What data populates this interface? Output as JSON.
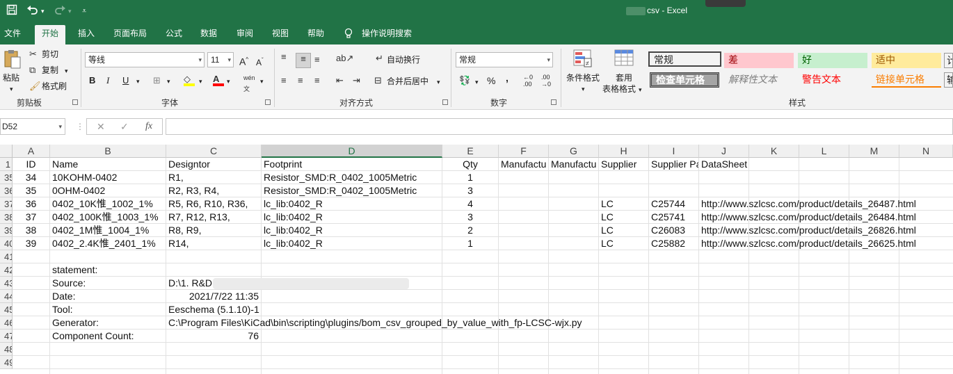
{
  "window": {
    "title_suffix": "csv  -  Excel"
  },
  "qat": {
    "save_icon": "save-icon",
    "undo_icon": "undo-icon",
    "redo_icon": "redo-icon",
    "customize_icon": "chevron-down-icon"
  },
  "tabs": [
    "文件",
    "开始",
    "插入",
    "页面布局",
    "公式",
    "数据",
    "审阅",
    "视图",
    "帮助"
  ],
  "tell_me": "操作说明搜索",
  "ribbon": {
    "clipboard": {
      "paste": "粘贴",
      "cut": "剪切",
      "copy": "复制",
      "format_painter": "格式刷",
      "label": "剪贴板"
    },
    "font": {
      "name": "等线",
      "size": "11",
      "bold": "B",
      "italic": "I",
      "underline": "U",
      "label": "字体",
      "grow": "A",
      "shrink": "A",
      "wen": "wén"
    },
    "alignment": {
      "wrap": "自动换行",
      "merge": "合并后居中",
      "label": "对齐方式"
    },
    "number": {
      "format": "常规",
      "percent": "%",
      "comma": ",",
      "label": "数字"
    },
    "styles": {
      "conditional": "条件格式",
      "table1": "套用",
      "table2": "表格格式",
      "label": "样式",
      "cells": [
        {
          "text": "常规",
          "bg": "#ffffff",
          "color": "#000000"
        },
        {
          "text": "差",
          "bg": "#ffc7ce",
          "color": "#9c0006"
        },
        {
          "text": "好",
          "bg": "#c6efce",
          "color": "#006100"
        },
        {
          "text": "适中",
          "bg": "#ffeb9c",
          "color": "#9c5700"
        },
        {
          "text": "检查单元格",
          "bg": "#a5a5a5",
          "color": "#ffffff"
        },
        {
          "text": "解释性文本",
          "bg": "#f3f3f3",
          "color": "#7f7f7f"
        },
        {
          "text": "警告文本",
          "bg": "#f3f3f3",
          "color": "#ff0000"
        },
        {
          "text": "链接单元格",
          "bg": "#f3f3f3",
          "color": "#fa7d00"
        }
      ]
    }
  },
  "formula_bar": {
    "name_box": "D52",
    "cancel": "✕",
    "enter": "✓",
    "fx": "fx",
    "value": ""
  },
  "columns": [
    "A",
    "B",
    "C",
    "D",
    "E",
    "F",
    "G",
    "H",
    "I",
    "J",
    "K",
    "L",
    "M",
    "N"
  ],
  "row_numbers": [
    "1",
    "35",
    "36",
    "37",
    "38",
    "39",
    "40",
    "41",
    "42",
    "43",
    "44",
    "45",
    "46",
    "47",
    "48",
    "49"
  ],
  "header_row": [
    "ID",
    "Name",
    "Designtor",
    "Footprint",
    "Qty",
    "Manufactu",
    "Manufactu",
    "Supplier",
    "Supplier Pa",
    "DataSheet"
  ],
  "rows": [
    [
      "34",
      "10KOHM-0402",
      "R1,",
      "Resistor_SMD:R_0402_1005Metric",
      "1",
      "",
      "",
      "",
      "",
      ""
    ],
    [
      "35",
      "0OHM-0402",
      "R2, R3, R4,",
      "Resistor_SMD:R_0402_1005Metric",
      "3",
      "",
      "",
      "",
      "",
      ""
    ],
    [
      "36",
      "0402_10K惟_1002_1%",
      "R5, R6, R10, R36,",
      "lc_lib:0402_R",
      "4",
      "",
      "",
      "LC",
      "C25744",
      "http://www.szlcsc.com/product/details_26487.html"
    ],
    [
      "37",
      "0402_100K惟_1003_1%",
      "R7, R12, R13,",
      "lc_lib:0402_R",
      "3",
      "",
      "",
      "LC",
      "C25741",
      "http://www.szlcsc.com/product/details_26484.html"
    ],
    [
      "38",
      "0402_1M惟_1004_1%",
      "R8, R9,",
      "lc_lib:0402_R",
      "2",
      "",
      "",
      "LC",
      "C26083",
      "http://www.szlcsc.com/product/details_26826.html"
    ],
    [
      "39",
      "0402_2.4K惟_2401_1%",
      "R14,",
      "lc_lib:0402_R",
      "1",
      "",
      "",
      "LC",
      "C25882",
      "http://www.szlcsc.com/product/details_26625.html"
    ]
  ],
  "footer": {
    "statement": "statement:",
    "source_label": "Source:",
    "source_value": "D:\\1. R&D",
    "date_label": "Date:",
    "date_value": "2021/7/22 11:35",
    "tool_label": "Tool:",
    "tool_value": "Eeschema (5.1.10)-1",
    "generator_label": "Generator:",
    "generator_value": "C:\\Program Files\\KiCad\\bin\\scripting\\plugins/bom_csv_grouped_by_value_with_fp-LCSC-wjx.py",
    "count_label": "Component Count:",
    "count_value": "76"
  },
  "colors": {
    "excel_green": "#217346",
    "ribbon_bg": "#f3f3f3",
    "header_bg": "#f0f0f0"
  }
}
